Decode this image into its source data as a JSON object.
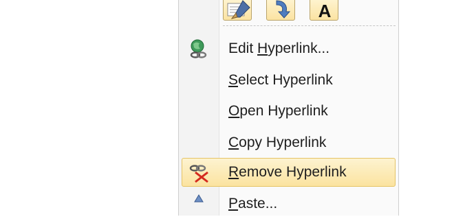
{
  "toolbar": {
    "buttons": [
      {
        "icon": "format-painter-icon"
      },
      {
        "icon": "change-style-icon"
      },
      {
        "icon": "font-a-icon",
        "glyph": "A"
      }
    ]
  },
  "menu": {
    "items": [
      {
        "pre": "Edit ",
        "key": "H",
        "post": "yperlink...",
        "icon": "edit-hyperlink-icon"
      },
      {
        "pre": "",
        "key": "S",
        "post": "elect Hyperlink",
        "icon": ""
      },
      {
        "pre": "",
        "key": "O",
        "post": "pen Hyperlink",
        "icon": ""
      },
      {
        "pre": "",
        "key": "C",
        "post": "opy Hyperlink",
        "icon": ""
      },
      {
        "pre": "",
        "key": "R",
        "post": "emove Hyperlink",
        "icon": "remove-hyperlink-icon",
        "highlighted": true
      },
      {
        "pre": "",
        "key": "P",
        "post": "aste...",
        "icon": "paste-icon"
      }
    ]
  },
  "colors": {
    "highlight_top": "#fdf3d0",
    "highlight_bottom": "#fbe3a0",
    "highlight_border": "#e5c365",
    "text": "#1e1e1e"
  }
}
